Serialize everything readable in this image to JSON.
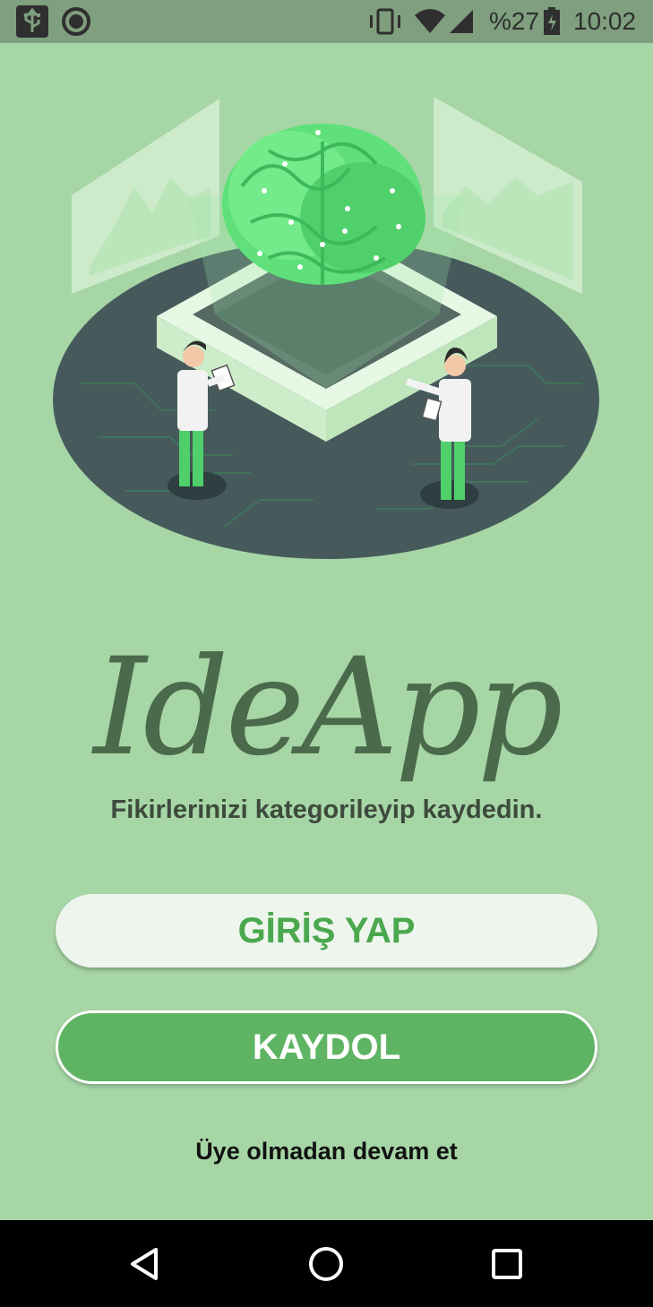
{
  "status_bar": {
    "battery": "%27",
    "time": "10:02",
    "icons": [
      "usb-icon",
      "sync-icon",
      "vibrate-icon",
      "wifi-icon",
      "signal-icon",
      "battery-icon"
    ]
  },
  "hero": {
    "illustration": "brain-platform-scientists-illustration"
  },
  "app": {
    "logo_text": "IdeApp",
    "tagline": "Fikirlerinizi kategorileyip kaydedin."
  },
  "buttons": {
    "login_label": "GİRİŞ YAP",
    "register_label": "KAYDOL"
  },
  "guest_link": "Üye olmadan devam et",
  "nav_bar": {
    "icons": [
      "back-icon",
      "home-icon",
      "recents-icon"
    ]
  },
  "colors": {
    "background": "#a6d6a5",
    "status_bar": "#7f9f7e",
    "primary_green": "#5fb463",
    "login_text": "#4aa84d",
    "logo": "#4b6a4b"
  }
}
